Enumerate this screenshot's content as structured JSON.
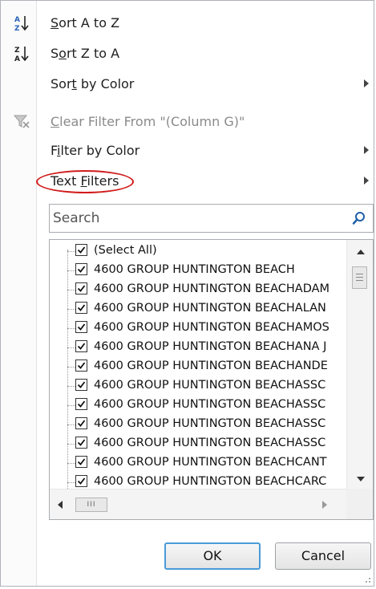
{
  "menu": {
    "items": [
      {
        "id": "sort-az",
        "pre": "",
        "acc": "S",
        "post": "ort A to Z",
        "icon": "sort-az-icon",
        "submenu": false,
        "disabled": false
      },
      {
        "id": "sort-za",
        "pre": "S",
        "acc": "o",
        "post": "rt Z to A",
        "icon": "sort-za-icon",
        "submenu": false,
        "disabled": false
      },
      {
        "id": "sort-color",
        "pre": "Sor",
        "acc": "t",
        "post": " by Color",
        "icon": "",
        "submenu": true,
        "disabled": false
      },
      {
        "id": "clear-filter",
        "pre": "",
        "acc": "C",
        "post": "lear Filter From \"(Column G)\"",
        "icon": "clear-filter-icon",
        "submenu": false,
        "disabled": true
      },
      {
        "id": "filter-color",
        "pre": "F",
        "acc": "i",
        "post": "lter by Color",
        "icon": "",
        "submenu": true,
        "disabled": false
      },
      {
        "id": "text-filters",
        "pre": "Text ",
        "acc": "F",
        "post": "ilters",
        "icon": "",
        "submenu": true,
        "disabled": false
      }
    ]
  },
  "search": {
    "placeholder": "Search",
    "value": "",
    "icon": "magnifier-icon"
  },
  "list": {
    "items": [
      {
        "label": "(Select All)",
        "checked": true
      },
      {
        "label": "4600 GROUP HUNTINGTON BEACH",
        "checked": true
      },
      {
        "label": "4600 GROUP HUNTINGTON BEACHADAM",
        "checked": true
      },
      {
        "label": "4600 GROUP HUNTINGTON BEACHALAN",
        "checked": true
      },
      {
        "label": "4600 GROUP HUNTINGTON BEACHAMOS",
        "checked": true
      },
      {
        "label": "4600 GROUP HUNTINGTON BEACHANA J",
        "checked": true
      },
      {
        "label": "4600 GROUP HUNTINGTON BEACHANDE",
        "checked": true
      },
      {
        "label": "4600 GROUP HUNTINGTON BEACHASSC",
        "checked": true
      },
      {
        "label": "4600 GROUP HUNTINGTON BEACHASSC",
        "checked": true
      },
      {
        "label": "4600 GROUP HUNTINGTON BEACHASSC",
        "checked": true
      },
      {
        "label": "4600 GROUP HUNTINGTON BEACHASSC",
        "checked": true
      },
      {
        "label": "4600 GROUP HUNTINGTON BEACHCANT",
        "checked": true
      },
      {
        "label": "4600 GROUP HUNTINGTON BEACHCARC",
        "checked": true
      }
    ],
    "hscroll_thumb_label": "III"
  },
  "buttons": {
    "ok": "OK",
    "cancel": "Cancel"
  },
  "colors": {
    "highlight_oval": "#d11a1a",
    "ok_focus_border": "#4a9bd8"
  }
}
